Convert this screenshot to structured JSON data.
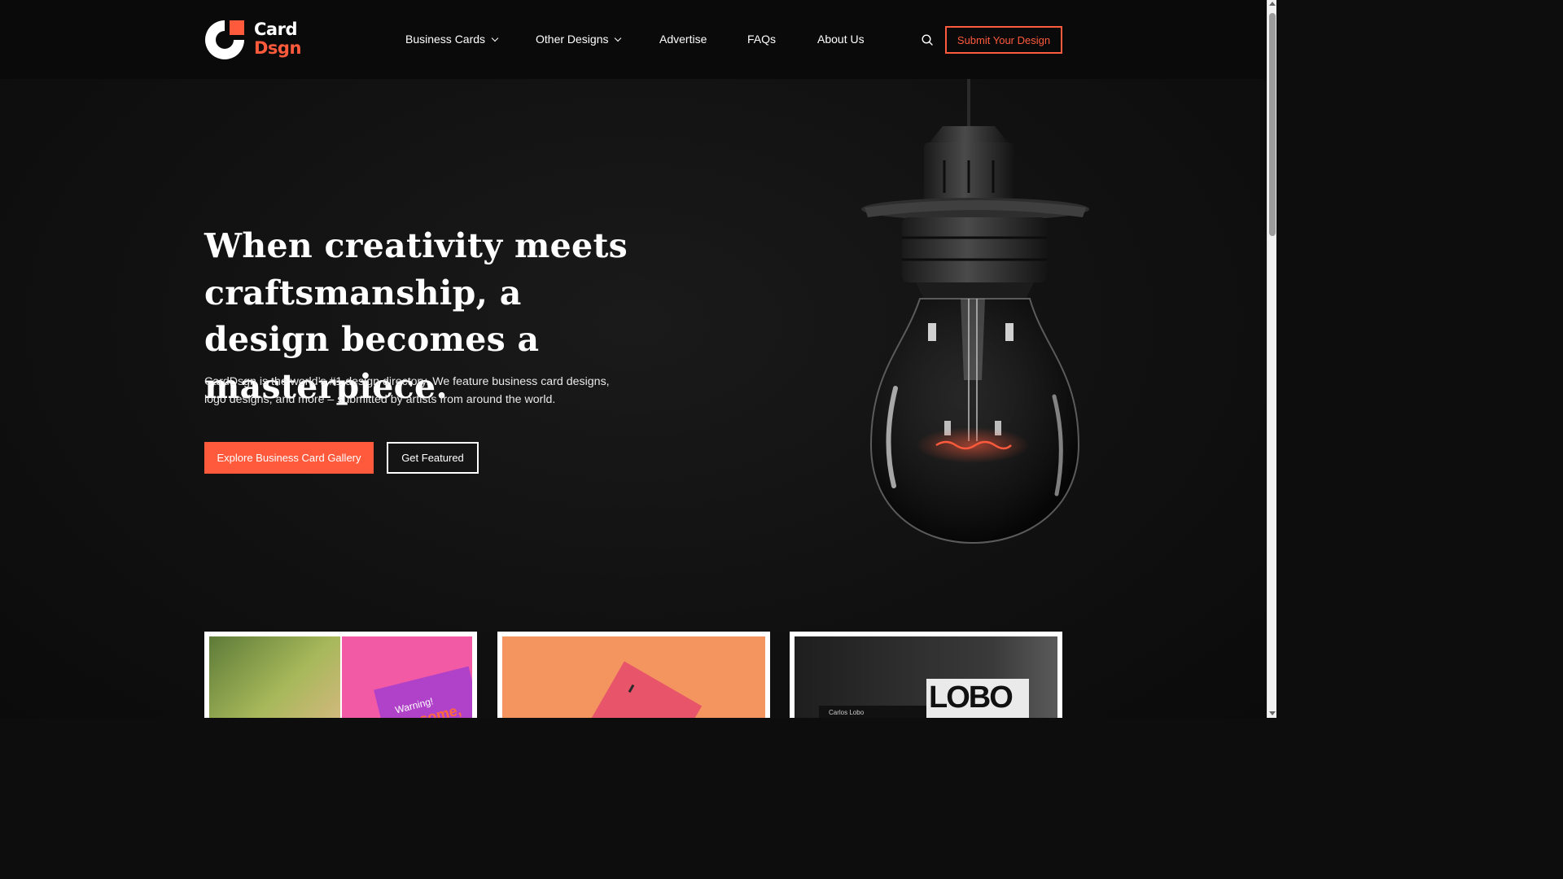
{
  "header": {
    "logo": {
      "line1": "Card",
      "line2": "Dsgn"
    },
    "nav": [
      {
        "label": "Business Cards",
        "has_dropdown": true
      },
      {
        "label": "Other Designs",
        "has_dropdown": true
      },
      {
        "label": "Advertise",
        "has_dropdown": false
      },
      {
        "label": "FAQs",
        "has_dropdown": false
      },
      {
        "label": "About Us",
        "has_dropdown": false
      }
    ],
    "search_icon": "search-icon",
    "submit_label": "Submit Your Design"
  },
  "hero": {
    "title": "When creativity meets craftsmanship, a design becomes a masterpiece.",
    "description": "CardDsgn is the world’s #1 design directory. We feature business card designs, logo designs, and more – submitted by artists from around the world.",
    "primary_button": "Explore Business Card Gallery",
    "secondary_button": "Get Featured"
  },
  "cards": [
    {
      "text1": "Warning!",
      "text2": "some,"
    },
    {},
    {
      "text1": "Carlos Lobo",
      "text2": "LOBO"
    }
  ],
  "colors": {
    "accent": "#ff5a3c",
    "background": "#0d0d0d"
  }
}
